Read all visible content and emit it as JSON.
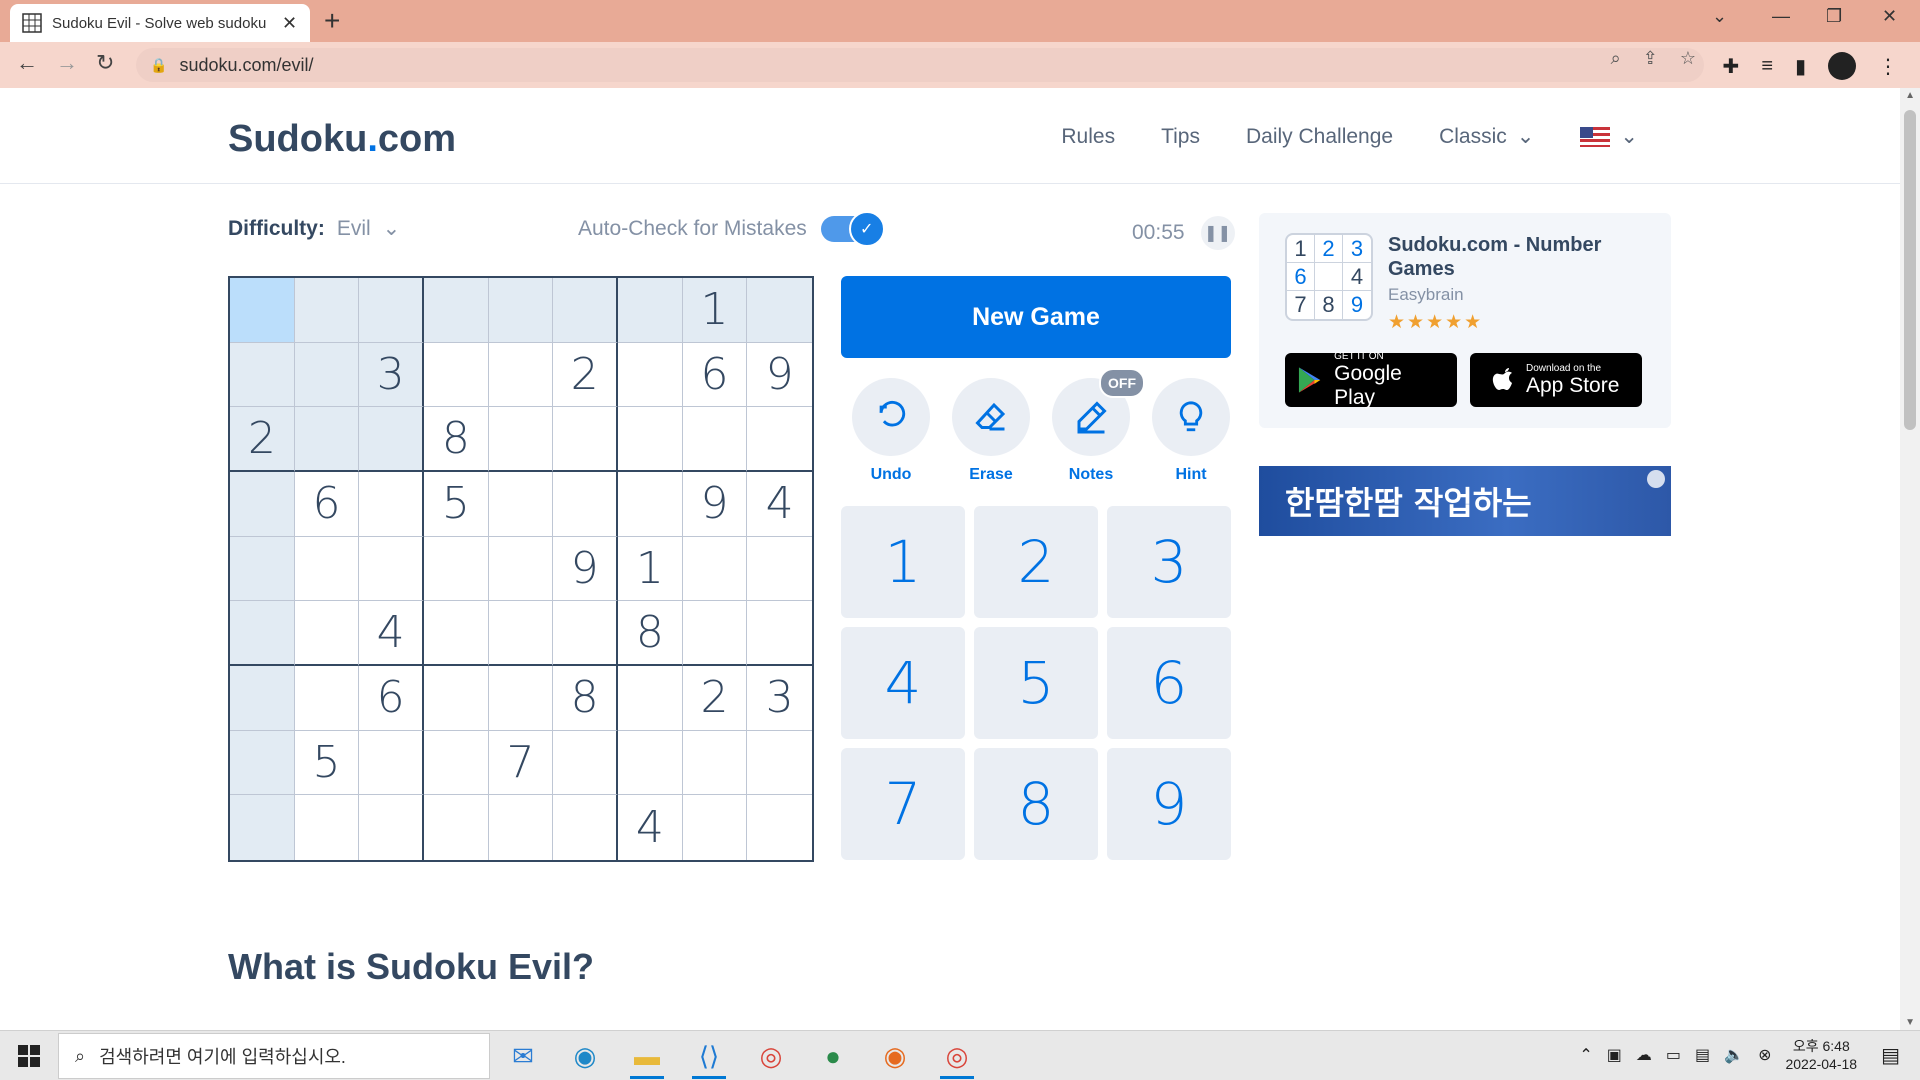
{
  "browser": {
    "tab_title": "Sudoku Evil - Solve web sudoku",
    "url": "sudoku.com/evil/"
  },
  "site": {
    "logo_main": "Sudoku",
    "logo_dot": ".",
    "logo_tld": "com",
    "nav": [
      "Rules",
      "Tips",
      "Daily Challenge",
      "Classic"
    ]
  },
  "game": {
    "difficulty_label": "Difficulty:",
    "difficulty_value": "Evil",
    "autocheck_label": "Auto-Check for Mistakes",
    "timer": "00:55",
    "new_game": "New Game",
    "tools": [
      "Undo",
      "Erase",
      "Notes",
      "Hint"
    ],
    "notes_badge": "OFF",
    "numpad": [
      "1",
      "2",
      "3",
      "4",
      "5",
      "6",
      "7",
      "8",
      "9"
    ],
    "grid": [
      [
        "",
        "",
        "",
        "",
        "",
        "",
        "",
        "1",
        ""
      ],
      [
        "",
        "",
        "3",
        "",
        "",
        "2",
        "",
        "6",
        "9"
      ],
      [
        "2",
        "",
        "",
        "8",
        "",
        "",
        "",
        "",
        ""
      ],
      [
        "",
        "6",
        "",
        "5",
        "",
        "",
        "",
        "9",
        "4"
      ],
      [
        "",
        "",
        "",
        "",
        "",
        "9",
        "1",
        "",
        ""
      ],
      [
        "",
        "",
        "4",
        "",
        "",
        "",
        "8",
        "",
        ""
      ],
      [
        "",
        "",
        "6",
        "",
        "",
        "8",
        "",
        "2",
        "3"
      ],
      [
        "",
        "5",
        "",
        "",
        "7",
        "",
        "",
        "",
        ""
      ],
      [
        "",
        "",
        "",
        "",
        "",
        "",
        "4",
        "",
        ""
      ]
    ],
    "selected": [
      0,
      0
    ]
  },
  "promo": {
    "app_name": "Sudoku.com - Number Games",
    "developer": "Easybrain",
    "stars": "★★★★★",
    "rating": 4.5,
    "mini_grid": [
      [
        "1",
        "2",
        "3"
      ],
      [
        "6",
        "",
        "4"
      ],
      [
        "7",
        "8",
        "9"
      ]
    ],
    "google_small": "GET IT ON",
    "google_big": "Google Play",
    "apple_small": "Download on the",
    "apple_big": "App Store"
  },
  "ad": {
    "text": "한땀한땀 작업하는"
  },
  "content": {
    "heading": "What is Sudoku Evil?"
  },
  "taskbar": {
    "search_placeholder": "검색하려면 여기에 입력하십시오.",
    "time": "오후 6:48",
    "date": "2022-04-18"
  },
  "colors": {
    "accent": "#0072e3",
    "text": "#344861",
    "tabbar": "#e8aa96"
  }
}
